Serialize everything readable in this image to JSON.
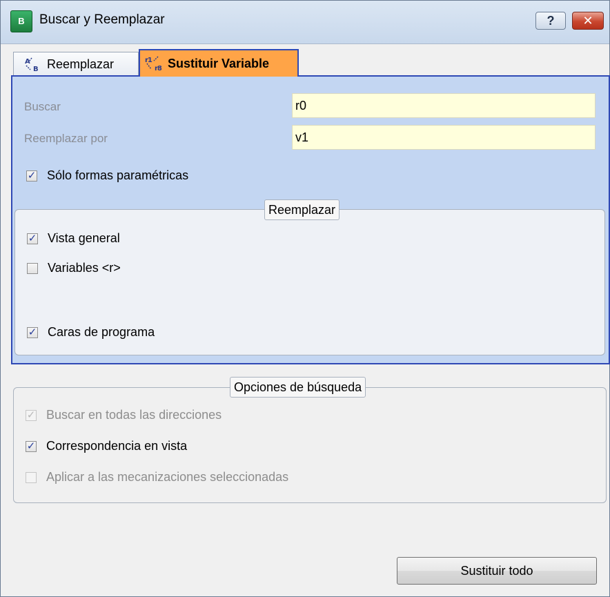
{
  "window": {
    "title": "Buscar y Reemplazar",
    "help_label": "?",
    "close_label": "✕",
    "app_icon_text": "B"
  },
  "tabs": [
    {
      "label": "Reemplazar",
      "active": false,
      "icon": "replace-icon"
    },
    {
      "label": "Sustituir Variable",
      "active": true,
      "icon": "substitute-variable-icon"
    }
  ],
  "fields": {
    "buscar": {
      "label": "Buscar",
      "value": "r0"
    },
    "reemplazar_por": {
      "label": "Reemplazar por",
      "value": "v1"
    }
  },
  "solo_formas": {
    "label": "Sólo formas paramétricas",
    "checked": true
  },
  "replace_group": {
    "title": "Reemplazar",
    "items": [
      {
        "label": "Vista general",
        "checked": true
      },
      {
        "label": "Variables <r>",
        "checked": false
      },
      {
        "label": "Caras de programa",
        "checked": true
      }
    ]
  },
  "options_group": {
    "title": "Opciones de búsqueda",
    "items": [
      {
        "label": "Buscar en todas las direcciones",
        "checked": true,
        "enabled": false
      },
      {
        "label": "Correspondencia en vista",
        "checked": true,
        "enabled": true
      },
      {
        "label": "Aplicar a las mecanizaciones seleccionadas",
        "checked": false,
        "enabled": false
      }
    ]
  },
  "actions": {
    "replace_all_label": "Sustituir todo"
  },
  "colors": {
    "active_tab": "#ffa447",
    "panel_background": "#c3d6f2",
    "panel_border": "#2f49b5",
    "input_background": "#ffffdc"
  }
}
